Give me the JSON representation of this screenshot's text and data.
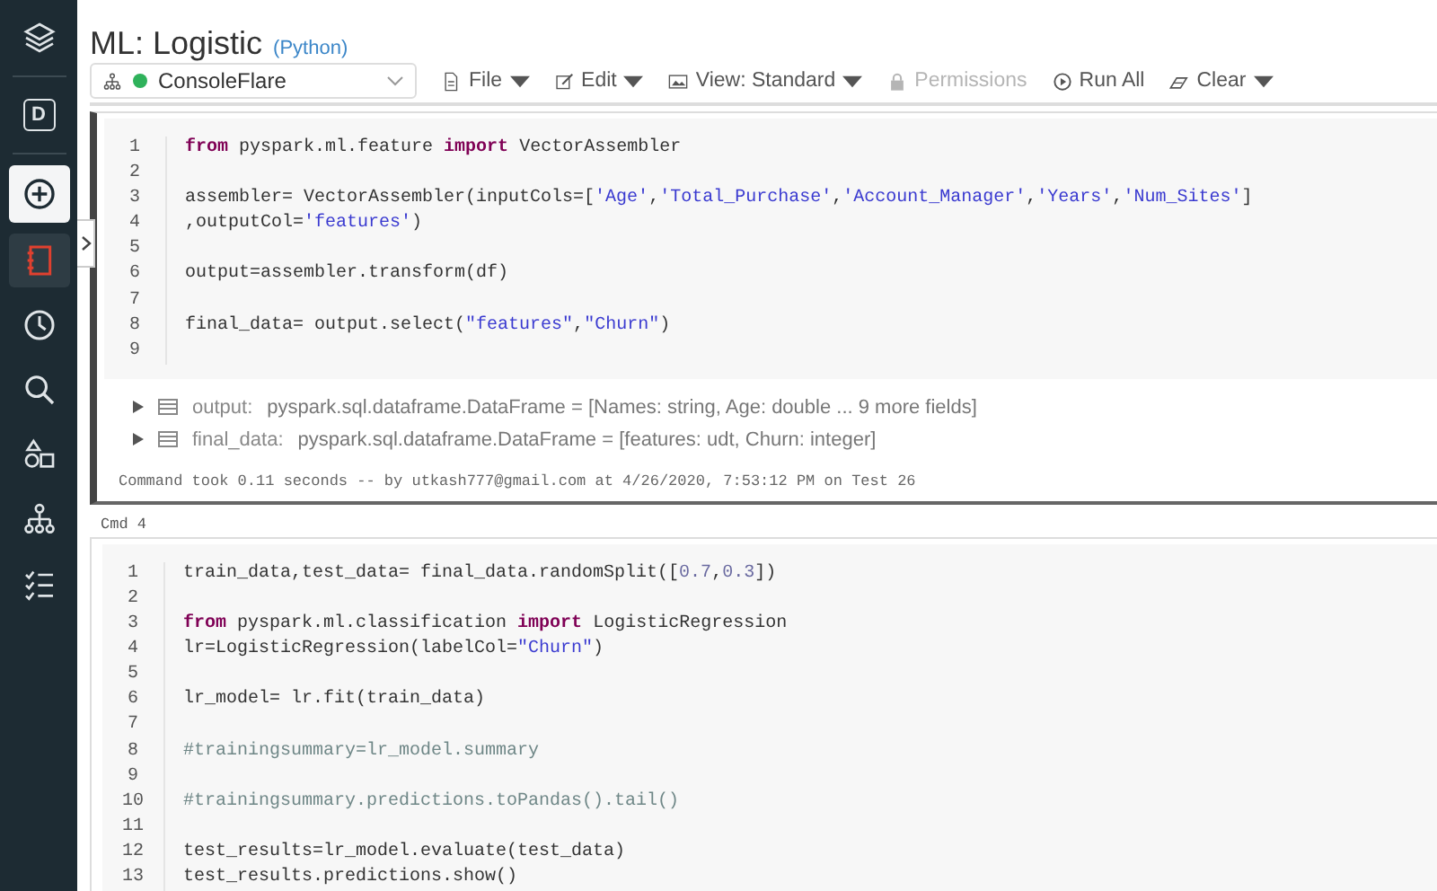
{
  "sidebar": {
    "items": [
      {
        "kind": "logo",
        "selected": false
      },
      {
        "kind": "workspace",
        "label": "D",
        "selected": false
      },
      {
        "kind": "create",
        "selected": false
      },
      {
        "kind": "notebook",
        "selected": true
      },
      {
        "kind": "recents",
        "selected": false
      },
      {
        "kind": "search",
        "selected": false
      },
      {
        "kind": "shapes",
        "selected": false
      },
      {
        "kind": "cluster",
        "selected": false
      },
      {
        "kind": "jobs",
        "selected": false
      }
    ]
  },
  "notebook": {
    "title": "ML: Logistic",
    "language": "(Python)"
  },
  "toolbar": {
    "cluster": {
      "name": "ConsoleFlare",
      "color": "#2fb25b"
    },
    "buttons": [
      {
        "kind": "file",
        "label": "File",
        "caret": true,
        "disabled": false
      },
      {
        "kind": "edit",
        "label": "Edit",
        "caret": true,
        "disabled": false
      },
      {
        "kind": "view",
        "label": "View: Standard",
        "caret": true,
        "disabled": false
      },
      {
        "kind": "permissions",
        "label": "Permissions",
        "caret": false,
        "disabled": true
      },
      {
        "kind": "run",
        "label": "Run All",
        "caret": false,
        "disabled": false
      },
      {
        "kind": "clear",
        "label": "Clear",
        "caret": true,
        "disabled": false
      }
    ]
  },
  "cells": [
    {
      "selected": true,
      "lines": [
        {
          "number": "1",
          "tokens": [
            {
              "kind": "keyword",
              "text": "from"
            },
            {
              "kind": "plain",
              "text": " pyspark.ml.feature "
            },
            {
              "kind": "keyword",
              "text": "import"
            },
            {
              "kind": "plain",
              "text": " VectorAssembler"
            }
          ]
        },
        {
          "number": "2"
        },
        {
          "number": "3",
          "tokens": [
            {
              "kind": "plain",
              "text": "assembler= VectorAssembler(inputCols=["
            },
            {
              "kind": "string",
              "text": "'Age'"
            },
            {
              "kind": "plain",
              "text": ","
            },
            {
              "kind": "string",
              "text": "'Total_Purchase'"
            },
            {
              "kind": "plain",
              "text": ","
            },
            {
              "kind": "string",
              "text": "'Account_Manager'"
            },
            {
              "kind": "plain",
              "text": ","
            },
            {
              "kind": "string",
              "text": "'Years'"
            },
            {
              "kind": "plain",
              "text": ","
            },
            {
              "kind": "string",
              "text": "'Num_Sites'"
            },
            {
              "kind": "plain",
              "text": "]"
            }
          ]
        },
        {
          "number": "4",
          "tokens": [
            {
              "kind": "plain",
              "text": ",outputCol="
            },
            {
              "kind": "string",
              "text": "'features'"
            },
            {
              "kind": "plain",
              "text": ")"
            }
          ]
        },
        {
          "number": "5"
        },
        {
          "number": "6",
          "tokens": [
            {
              "kind": "plain",
              "text": "output=assembler.transform(df)"
            }
          ]
        },
        {
          "number": "7"
        },
        {
          "number": "8",
          "tokens": [
            {
              "kind": "plain",
              "text": "final_data= output.select("
            },
            {
              "kind": "string",
              "text": "\"features\""
            },
            {
              "kind": "plain",
              "text": ","
            },
            {
              "kind": "string",
              "text": "\"Churn\""
            },
            {
              "kind": "plain",
              "text": ")"
            }
          ]
        },
        {
          "number": "9"
        }
      ],
      "outputs": [
        {
          "name": "output:",
          "value": "pyspark.sql.dataframe.DataFrame = [Names: string, Age: double ... 9 more fields]",
          "expanded": false
        },
        {
          "name": "final_data:",
          "value": "pyspark.sql.dataframe.DataFrame = [features: udt, Churn: integer]",
          "expanded": false
        }
      ],
      "footer": "Command took 0.11 seconds -- by utkash777@gmail.com at 4/26/2020, 7:53:12 PM on Test 26"
    },
    {
      "label": "Cmd 4",
      "selected": false,
      "lines": [
        {
          "number": "1",
          "tokens": [
            {
              "kind": "plain",
              "text": "train_data,test_data= final_data.randomSplit(["
            },
            {
              "kind": "number",
              "text": "0.7"
            },
            {
              "kind": "plain",
              "text": ","
            },
            {
              "kind": "number",
              "text": "0.3"
            },
            {
              "kind": "plain",
              "text": "])"
            }
          ]
        },
        {
          "number": "2"
        },
        {
          "number": "3",
          "tokens": [
            {
              "kind": "keyword",
              "text": "from"
            },
            {
              "kind": "plain",
              "text": " pyspark.ml.classification "
            },
            {
              "kind": "keyword",
              "text": "import"
            },
            {
              "kind": "plain",
              "text": " LogisticRegression"
            }
          ]
        },
        {
          "number": "4",
          "tokens": [
            {
              "kind": "plain",
              "text": "lr=LogisticRegression(labelCol="
            },
            {
              "kind": "string",
              "text": "\"Churn\""
            },
            {
              "kind": "plain",
              "text": ")"
            }
          ]
        },
        {
          "number": "5"
        },
        {
          "number": "6",
          "tokens": [
            {
              "kind": "plain",
              "text": "lr_model= lr.fit(train_data)"
            }
          ]
        },
        {
          "number": "7"
        },
        {
          "number": "8",
          "tokens": [
            {
              "kind": "comment",
              "text": "#trainingsummary=lr_model.summary"
            }
          ]
        },
        {
          "number": "9"
        },
        {
          "number": "10",
          "tokens": [
            {
              "kind": "comment",
              "text": "#trainingsummary.predictions.toPandas().tail()"
            }
          ]
        },
        {
          "number": "11"
        },
        {
          "number": "12",
          "tokens": [
            {
              "kind": "plain",
              "text": "test_results=lr_model.evaluate(test_data)"
            }
          ]
        },
        {
          "number": "13",
          "tokens": [
            {
              "kind": "plain",
              "text": "test_results.predictions.show()"
            }
          ]
        }
      ]
    }
  ]
}
